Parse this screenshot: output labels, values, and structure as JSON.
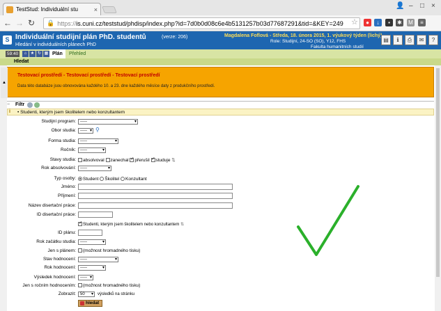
{
  "browser": {
    "tab_title": "TestStud: Individuální stu",
    "url_prefix": "https://",
    "url": "is.cuni.cz/teststud/phdisp/index.php?id=7d0b0d08c6e4b5131257b03d77687291&tid=&KEY=249"
  },
  "header": {
    "title": "Individuální studijní plán PhD. studentů",
    "version": "(verze: 206)",
    "subtitle": "Hledání v individuálních plánech PhD",
    "user_line": "Magdalena Foflová - Středa, 18. února 2015, 1. výukový týden (lichý)",
    "role_line": "Role: Studijní, 24-SO (SO), Y12, FHS",
    "faculty_line": "Fakulta humanitních studií"
  },
  "nav": {
    "timer": "59:40",
    "tab_plan": "Plán",
    "tab_prehled": "Přehled",
    "sub_hledat": "Hledat"
  },
  "warning": {
    "title": "Testovací prostředí - Testovací prostředí - Testovací prostředí",
    "text": "Data této databáze jsou obnovována každého 10. a 23. dne každého měsíce daty z produkčního prostředí."
  },
  "filter": {
    "label": "Filtr",
    "info": "Studenti, kterým jsem školitelem nebo konzultantem"
  },
  "form": {
    "studijni_program": {
      "label": "Studijní program:",
      "value": "-----"
    },
    "obor_studia": {
      "label": "Obor studia:",
      "value": "-----"
    },
    "forma_studia": {
      "label": "Forma studia:",
      "value": "-----"
    },
    "rocnik": {
      "label": "Ročník:",
      "value": "-----"
    },
    "stavy_studia": {
      "label": "Stavy studia:",
      "options": [
        "absolvoval",
        "zanechal",
        "přerušil",
        "studuje"
      ]
    },
    "rok_absolvovani": {
      "label": "Rok absolvování:",
      "value": "-----"
    },
    "typ_osoby": {
      "label": "Typ osoby:",
      "options": [
        "Student",
        "Školitel",
        "Konzultant"
      ]
    },
    "jmeno": {
      "label": "Jméno:"
    },
    "prijmeni": {
      "label": "Příjmení:"
    },
    "nazev_dis": {
      "label": "Název disertační práce:"
    },
    "id_dis": {
      "label": "ID disertační práce:"
    },
    "skolitel_check": {
      "label": "Studenti, kterým jsem školitelem nebo konzultantem"
    },
    "id_planu": {
      "label": "ID plánu:"
    },
    "rok_zacatku": {
      "label": "Rok začátku studia:",
      "value": "-----"
    },
    "jen_s_planem": {
      "label": "Jen s plánem:",
      "note": "(možnost hromadného tisku)"
    },
    "stav_hodnoceni": {
      "label": "Stav hodnocení:",
      "value": "-----"
    },
    "rok_hodnoceni": {
      "label": "Rok hodnocení:",
      "value": "-----"
    },
    "vysledek": {
      "label": "Výsledek hodnocení:",
      "value": "-----"
    },
    "jen_s_rocnim": {
      "label": "Jen s ročním hodnocením:",
      "note": "(možnost hromadného tisku)"
    },
    "zobrazit": {
      "label": "Zobrazit:",
      "value": "50",
      "suffix": "výsledků na stránku"
    },
    "submit": "hledat"
  },
  "colors": {
    "header_blue": "#1e66b0",
    "nav_green": "#d8e4a4",
    "warning_orange": "#f6a400",
    "check_green": "#2bb02b"
  }
}
